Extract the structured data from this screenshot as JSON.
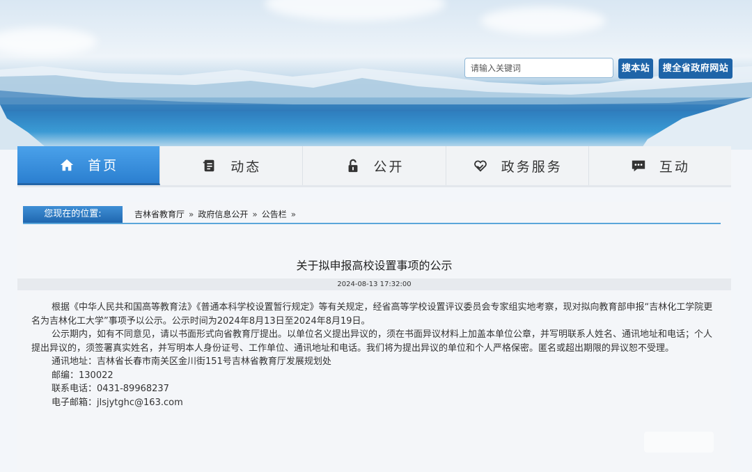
{
  "search": {
    "placeholder": "请输入关键词",
    "btn_site": "搜本站",
    "btn_gov": "搜全省政府网站"
  },
  "nav": [
    {
      "label": "首页",
      "icon": "home-icon",
      "active": true
    },
    {
      "label": "动态",
      "icon": "document-icon",
      "active": false
    },
    {
      "label": "公开",
      "icon": "lock-icon",
      "active": false
    },
    {
      "label": "政务服务",
      "icon": "heart-hand-icon",
      "active": false
    },
    {
      "label": "互动",
      "icon": "chat-icon",
      "active": false
    }
  ],
  "breadcrumb": {
    "prefix": "您现在的位置:",
    "items": [
      "吉林省教育厅",
      "政府信息公开",
      "公告栏"
    ],
    "separator": "»"
  },
  "article": {
    "title": "关于拟申报高校设置事项的公示",
    "date": "2024-08-13 17:32:00",
    "para1": "根据《中华人民共和国高等教育法》《普通本科学校设置暂行规定》等有关规定，经省高等学校设置评议委员会专家组实地考察，现对拟向教育部申报“吉林化工学院更名为吉林化工大学”事项予以公示。公示时间为2024年8月13日至2024年8月19日。",
    "para2": "公示期内，如有不同意见，请以书面形式向省教育厅提出。以单位名义提出异议的，须在书面异议材料上加盖本单位公章，并写明联系人姓名、通讯地址和电话；个人提出异议的，须签署真实姓名，并写明本人身份证号、工作单位、通讯地址和电话。我们将为提出异议的单位和个人严格保密。匿名或超出期限的异议恕不受理。",
    "address": "通讯地址：吉林省长春市南关区金川街151号吉林省教育厅发展规划处",
    "postcode": "邮编：130022",
    "phone": "联系电话：0431-89968237",
    "email": "电子邮箱：jlsjytghc@163.com"
  }
}
